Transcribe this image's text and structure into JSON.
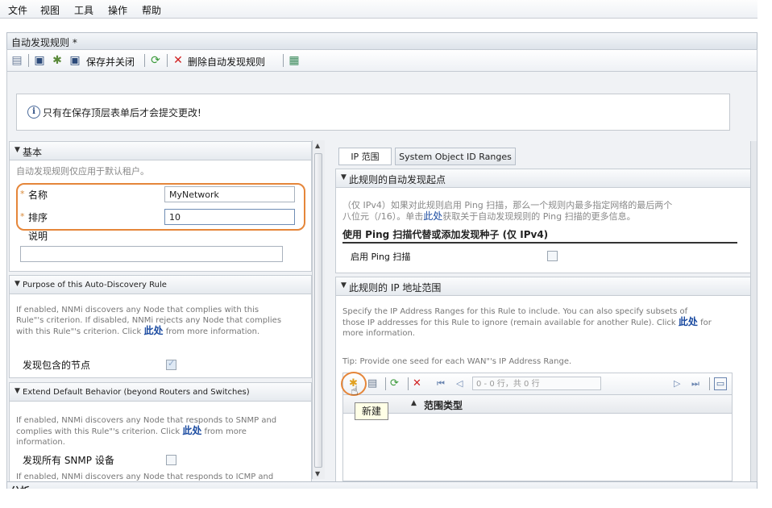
{
  "menubar": {
    "items": [
      "文件",
      "视图",
      "工具",
      "操作",
      "帮助"
    ]
  },
  "tab": {
    "title": "自动发现规则 *"
  },
  "toolbar": {
    "save_close": "保存并关闭",
    "delete_rule": "删除自动发现规则"
  },
  "notice": {
    "text": "只有在保存顶层表单后才会提交更改!"
  },
  "basic": {
    "header": "基本",
    "note": "自动发现规则仅应用于默认租户。",
    "name_label": "名称",
    "name_value": "MyNetwork",
    "order_label": "排序",
    "order_value": "10",
    "desc_label": "说明",
    "desc_value": ""
  },
  "purpose": {
    "header": "Purpose of this Auto-Discovery Rule",
    "text": "If enabled, NNMi discovers any Node that complies with this Rule\"'s criterion. If disabled, NNMi rejects any Node that complies with this Rule\"'s criterion. Click",
    "link": "此处",
    "text2": "from more information.",
    "field_label": "发现包含的节点",
    "field_checked": true
  },
  "extend": {
    "header": "Extend Default Behavior (beyond Routers and Switches)",
    "text": "If enabled, NNMi discovers any Node that responds to SNMP and complies with this Rule\"'s criterion. Click",
    "link": "此处",
    "text2": "from more information.",
    "field_label": "发现所有 SNMP 设备",
    "field_checked": false,
    "cut_text": "If enabled, NNMi discovers any Node that responds to ICMP and"
  },
  "right_tabs": {
    "tab1": "IP 范围",
    "tab2": "System Object ID Ranges"
  },
  "starting_points": {
    "header": "此规则的自动发现起点",
    "para1": "（仅 IPv4）如果对此规则启用 Ping 扫描，那么一个规则内最多指定网络的最后两个",
    "para2_a": "八位元（/16）。单击",
    "para2_link": "此处",
    "para2_b": "获取关于自动发现规则的 Ping 扫描的更多信息。",
    "subheader": "使用 Ping 扫描代替或添加发现种子 (仅 IPv4)",
    "ping_label": "启用 Ping 扫描",
    "ping_checked": false
  },
  "ip_ranges": {
    "header": "此规则的 IP 地址范围",
    "text1": "Specify the IP Address Ranges for this Rule to include. You can also specify subsets of",
    "text2": "those IP addresses for this Rule to ignore (remain available for another Rule). Click",
    "link": "此处",
    "text2b": "for",
    "text3": "more information.",
    "tip": "Tip: Provide one seed for each WAN\"'s IP Address Range.",
    "pager": "0 - 0 行，共 0 行",
    "col_header": "范围类型",
    "tooltip": "新建"
  },
  "bottom": {
    "label": "分析"
  },
  "colors": {
    "highlight": "#e5863a",
    "link": "#1a4aa0"
  }
}
